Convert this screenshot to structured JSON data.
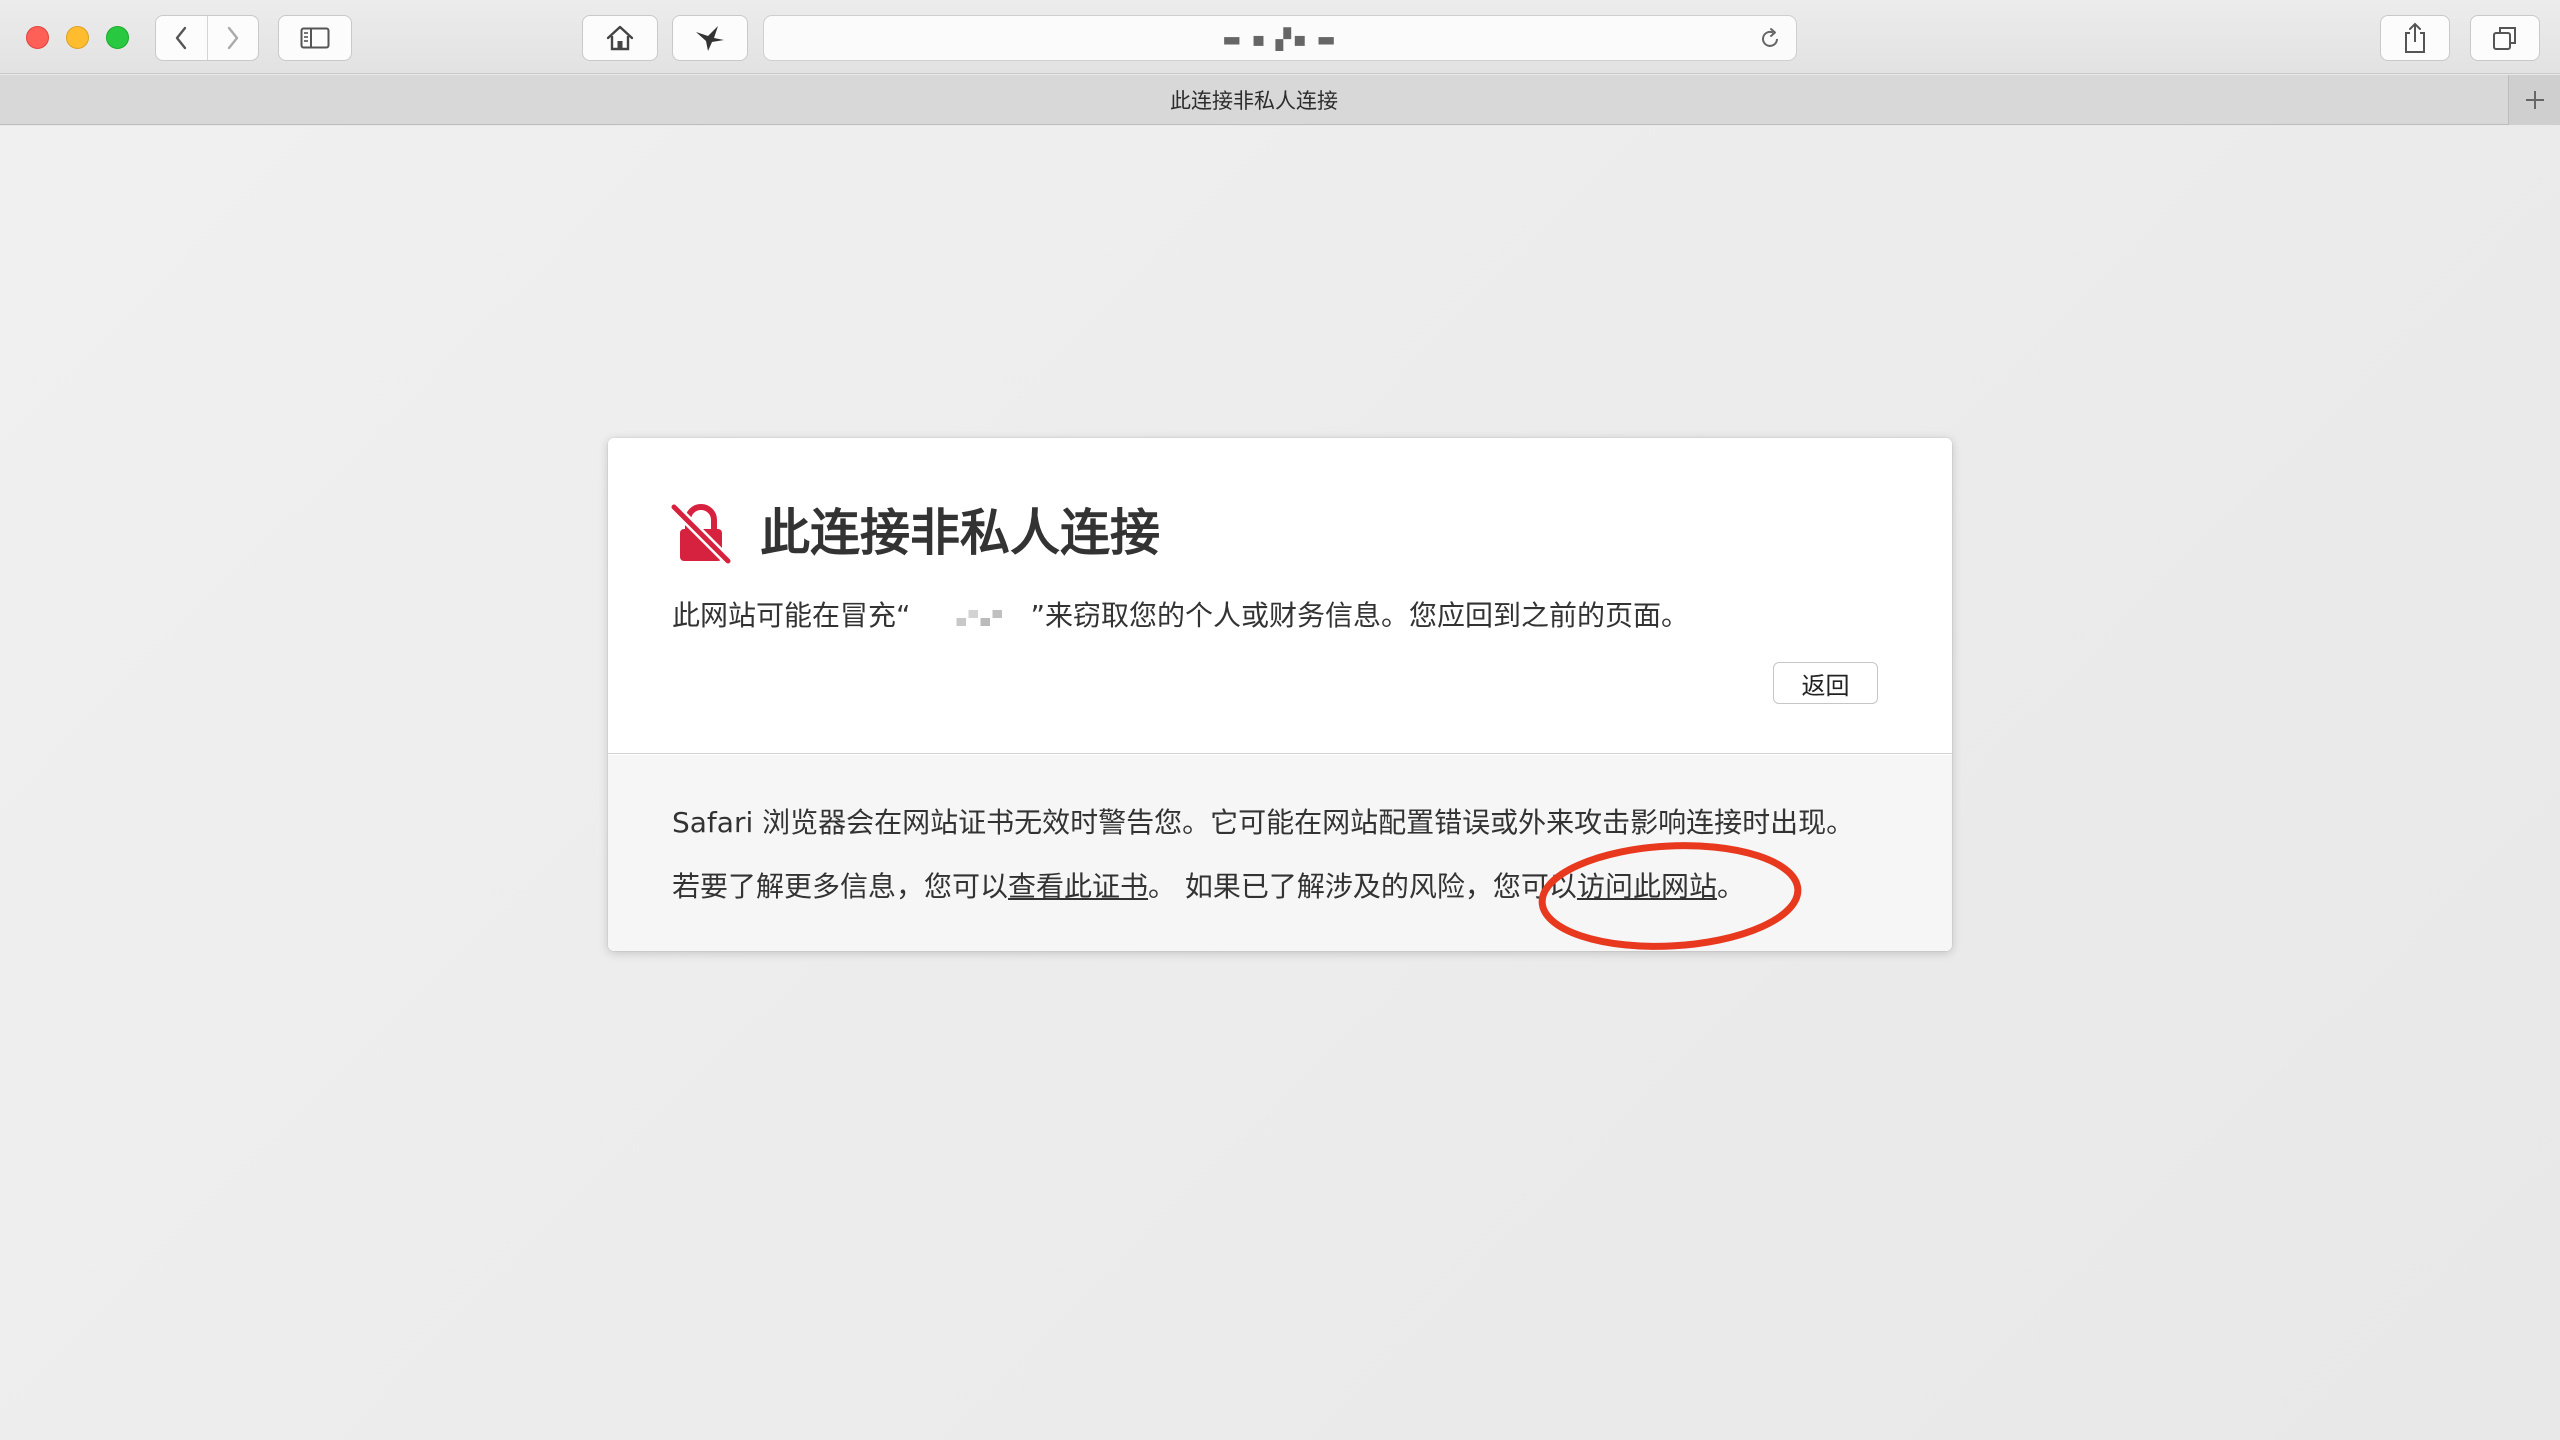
{
  "browser": {
    "address_url": "▬ ▪ ▞▪ ▬",
    "tab_title": "此连接非私人连接",
    "new_tab_symbol": "+"
  },
  "warning": {
    "title": "此连接非私人连接",
    "subtitle_before": "此网站可能在冒充“",
    "subtitle_after": "”来窃取您的个人或财务信息。您应回到之前的页面。",
    "back_button": "返回",
    "icon_color": "#d6223f"
  },
  "details": {
    "line1": "Safari 浏览器会在网站证书无效时警告您。它可能在网站配置错误或外来攻击影响连接时出现。",
    "line2_before": "若要了解更多信息，您可以",
    "view_certificate_link": "查看此证书",
    "line2_middle": "。 如果已了解涉及的风险，您可以",
    "visit_site_link": "访问此网站",
    "line2_after": "。"
  },
  "annotation_color": "#e8391e"
}
